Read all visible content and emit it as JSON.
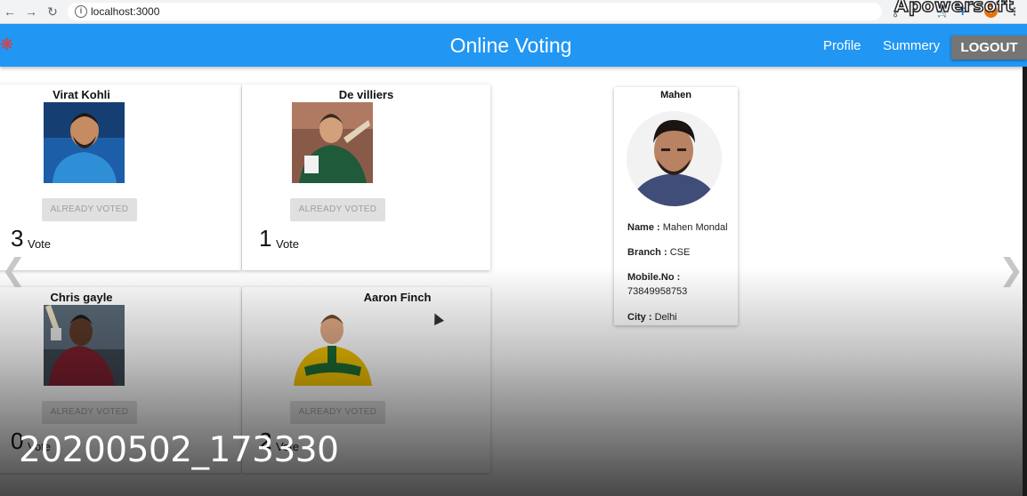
{
  "browser": {
    "url": "localhost:3000",
    "watermark": "Apowersoft",
    "profile_initial": "T"
  },
  "app": {
    "title": "Online Voting",
    "nav": {
      "profile": "Profile",
      "summary": "Summery",
      "logout": "LOGOUT"
    }
  },
  "candidates": [
    {
      "name": "Virat Kohli",
      "button": "ALREADY VOTED",
      "votes": "3",
      "vote_label": "Vote",
      "jersey": "#2f8fd6"
    },
    {
      "name": "De villiers",
      "button": "ALREADY VOTED",
      "votes": "1",
      "vote_label": "Vote",
      "jersey": "#1f5a3a"
    },
    {
      "name": "Chris gayle",
      "button": "ALREADY VOTED",
      "votes": "0",
      "vote_label": "Vote",
      "jersey": "#7a1f2e"
    },
    {
      "name": "Aaron Finch",
      "button": "ALREADY VOTED",
      "votes": "2",
      "vote_label": "Vote",
      "jersey": "#f2c200"
    }
  ],
  "profile": {
    "name": "Mahen",
    "full_name_label": "Name :",
    "full_name": "Mahen Mondal",
    "branch_label": "Branch :",
    "branch": "CSE",
    "mobile_label": "Mobile.No :",
    "mobile": "73849958753",
    "city_label": "City :",
    "city": "Delhi"
  },
  "overlay": {
    "timestamp": "20200502_173330"
  },
  "colors": {
    "appbar": "#2196f3",
    "logout_bg": "#757575",
    "disabled_button": "#e0e0e0"
  }
}
